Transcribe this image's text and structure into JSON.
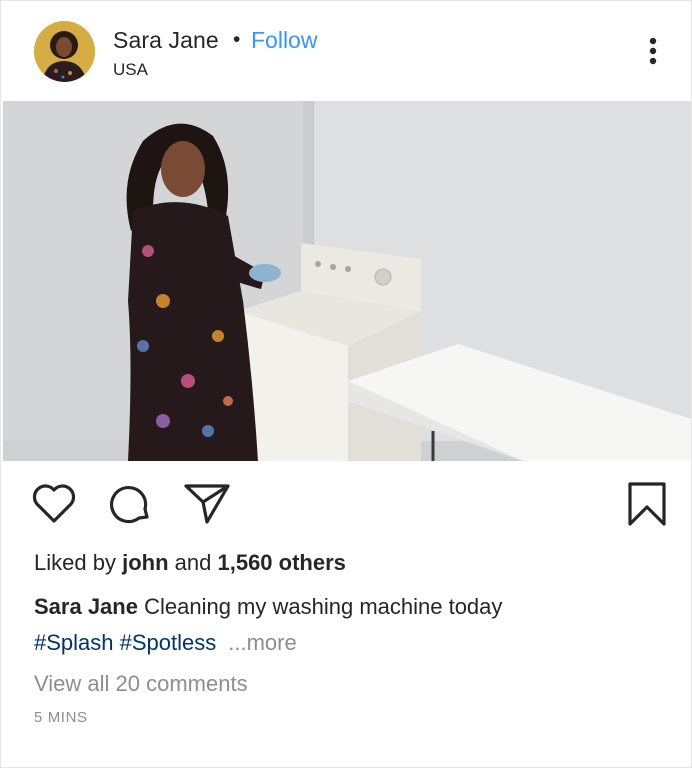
{
  "post": {
    "user": {
      "name": "Sara Jane",
      "separator": "•",
      "follow_label": "Follow",
      "location": "USA"
    },
    "menu_icon": "more-vertical-icon",
    "actions": {
      "like_icon": "heart-icon",
      "comment_icon": "comment-bubble-icon",
      "share_icon": "paper-plane-icon",
      "save_icon": "bookmark-icon"
    },
    "likes": {
      "prefix": "Liked by",
      "user": "john",
      "and": "and",
      "others": "1,560 others"
    },
    "caption": {
      "user": "Sara Jane",
      "text": "Cleaning my washing machine today"
    },
    "hashtags": [
      "#Splash",
      "#Spotless"
    ],
    "more_label": "...more",
    "comments_label": "View all 20 comments",
    "time": "5 MINS",
    "colors": {
      "follow": "#3897f0",
      "hashtag": "#003569",
      "muted": "#8e8e8e",
      "text": "#262626"
    }
  }
}
